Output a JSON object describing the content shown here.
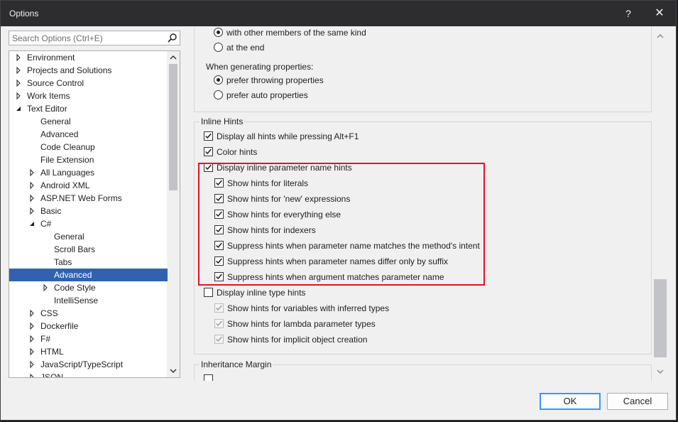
{
  "window": {
    "title": "Options",
    "help": "?",
    "close": "✕"
  },
  "search": {
    "placeholder": "Search Options (Ctrl+E)"
  },
  "tree": [
    {
      "label": "Environment",
      "level": 0,
      "arrow": "collapsed"
    },
    {
      "label": "Projects and Solutions",
      "level": 0,
      "arrow": "collapsed"
    },
    {
      "label": "Source Control",
      "level": 0,
      "arrow": "collapsed"
    },
    {
      "label": "Work Items",
      "level": 0,
      "arrow": "collapsed"
    },
    {
      "label": "Text Editor",
      "level": 0,
      "arrow": "expanded"
    },
    {
      "label": "General",
      "level": 1,
      "arrow": "none"
    },
    {
      "label": "Advanced",
      "level": 1,
      "arrow": "none"
    },
    {
      "label": "Code Cleanup",
      "level": 1,
      "arrow": "none"
    },
    {
      "label": "File Extension",
      "level": 1,
      "arrow": "none"
    },
    {
      "label": "All Languages",
      "level": 1,
      "arrow": "collapsed"
    },
    {
      "label": "Android XML",
      "level": 1,
      "arrow": "collapsed"
    },
    {
      "label": "ASP.NET Web Forms",
      "level": 1,
      "arrow": "collapsed"
    },
    {
      "label": "Basic",
      "level": 1,
      "arrow": "collapsed"
    },
    {
      "label": "C#",
      "level": 1,
      "arrow": "expanded"
    },
    {
      "label": "General",
      "level": 2,
      "arrow": "none"
    },
    {
      "label": "Scroll Bars",
      "level": 2,
      "arrow": "none"
    },
    {
      "label": "Tabs",
      "level": 2,
      "arrow": "none"
    },
    {
      "label": "Advanced",
      "level": 2,
      "arrow": "none",
      "selected": true
    },
    {
      "label": "Code Style",
      "level": 2,
      "arrow": "collapsed"
    },
    {
      "label": "IntelliSense",
      "level": 2,
      "arrow": "none"
    },
    {
      "label": "CSS",
      "level": 1,
      "arrow": "collapsed"
    },
    {
      "label": "Dockerfile",
      "level": 1,
      "arrow": "collapsed"
    },
    {
      "label": "F#",
      "level": 1,
      "arrow": "collapsed"
    },
    {
      "label": "HTML",
      "level": 1,
      "arrow": "collapsed"
    },
    {
      "label": "JavaScript/TypeScript",
      "level": 1,
      "arrow": "collapsed"
    },
    {
      "label": "JSON",
      "level": 1,
      "arrow": "collapsed"
    }
  ],
  "properties_group": {
    "radio_other_members": {
      "label": "with other members of the same kind",
      "checked": true
    },
    "radio_at_end": {
      "label": "at the end",
      "checked": false
    },
    "generating_label": "When generating properties:",
    "radio_prefer_throwing": {
      "label": "prefer throwing properties",
      "checked": true
    },
    "radio_prefer_auto": {
      "label": "prefer auto properties",
      "checked": false
    }
  },
  "inline_hints": {
    "header": "Inline Hints",
    "items": [
      {
        "label": "Display all hints while pressing Alt+F1",
        "checked": true,
        "indent": 0,
        "disabled": false
      },
      {
        "label": "Color hints",
        "checked": true,
        "indent": 0,
        "disabled": false
      },
      {
        "label": "Display inline parameter name hints",
        "checked": true,
        "indent": 0,
        "disabled": false
      },
      {
        "label": "Show hints for literals",
        "checked": true,
        "indent": 1,
        "disabled": false
      },
      {
        "label": "Show hints for 'new' expressions",
        "checked": true,
        "indent": 1,
        "disabled": false
      },
      {
        "label": "Show hints for everything else",
        "checked": true,
        "indent": 1,
        "disabled": false
      },
      {
        "label": "Show hints for indexers",
        "checked": true,
        "indent": 1,
        "disabled": false
      },
      {
        "label": "Suppress hints when parameter name matches the method's intent",
        "checked": true,
        "indent": 1,
        "disabled": false
      },
      {
        "label": "Suppress hints when parameter names differ only by suffix",
        "checked": true,
        "indent": 1,
        "disabled": false
      },
      {
        "label": "Suppress hints when argument matches parameter name",
        "checked": true,
        "indent": 1,
        "disabled": false
      },
      {
        "label": "Display inline type hints",
        "checked": false,
        "indent": 0,
        "disabled": false
      },
      {
        "label": "Show hints for variables with inferred types",
        "checked": true,
        "indent": 1,
        "disabled": true
      },
      {
        "label": "Show hints for lambda parameter types",
        "checked": true,
        "indent": 1,
        "disabled": true
      },
      {
        "label": "Show hints for implicit object creation",
        "checked": true,
        "indent": 1,
        "disabled": true
      }
    ]
  },
  "inheritance_margin": {
    "header": "Inheritance Margin"
  },
  "buttons": {
    "ok": "OK",
    "cancel": "Cancel"
  },
  "colors": {
    "selection": "#3062b0",
    "highlight_box": "#e81123",
    "titlebar": "#2d2d30",
    "ok_border": "#3399ff"
  }
}
